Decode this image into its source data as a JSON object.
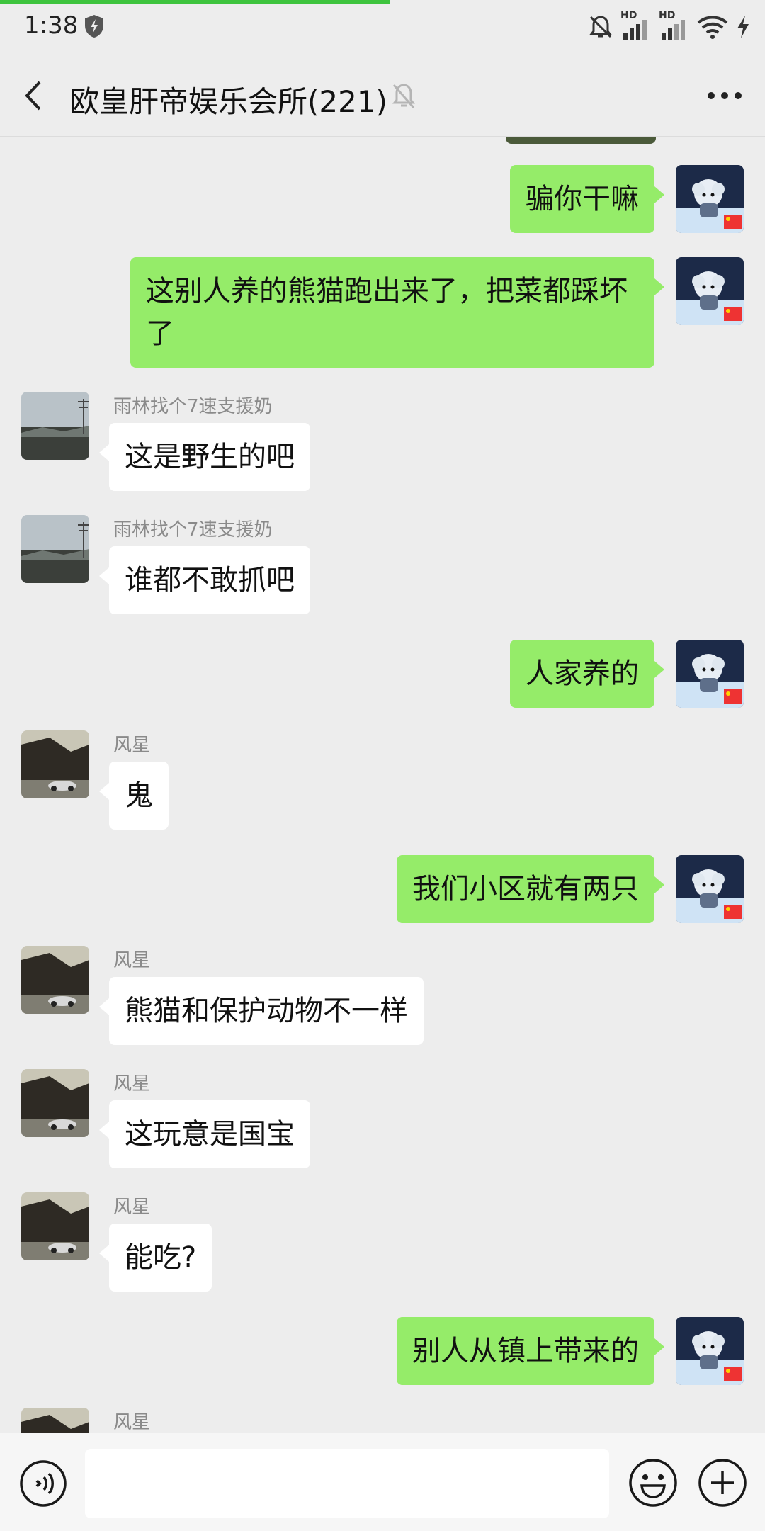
{
  "status_bar": {
    "time": "1:38",
    "icons": [
      "shield-icon",
      "mute-bell-icon",
      "hd-signal-icon",
      "hd-signal-icon",
      "wifi-icon",
      "charging-icon"
    ],
    "hd1": "HD",
    "hd2": "HD"
  },
  "header": {
    "title": "欧皇肝帝娱乐会所(221)",
    "back_icon": "back-arrow-icon",
    "mute_icon": "muted-bell-icon",
    "more_icon": "more-icon"
  },
  "colors": {
    "background": "#ededed",
    "outgoing_bubble": "#95ec69",
    "incoming_bubble": "#ffffff",
    "name_text": "#8a8a8a",
    "progress_bar": "#3ec43e"
  },
  "messages": [
    {
      "direction": "out",
      "text": "骗你干嘛"
    },
    {
      "direction": "out",
      "text": "这别人养的熊猫跑出来了，把菜都踩坏了"
    },
    {
      "direction": "in",
      "sender": "雨林找个7速支援奶",
      "text": "这是野生的吧"
    },
    {
      "direction": "in",
      "sender": "雨林找个7速支援奶",
      "text": "谁都不敢抓吧"
    },
    {
      "direction": "out",
      "text": "人家养的"
    },
    {
      "direction": "in",
      "sender": "风星",
      "text": "鬼"
    },
    {
      "direction": "out",
      "text": "我们小区就有两只"
    },
    {
      "direction": "in",
      "sender": "风星",
      "text": "熊猫和保护动物不一样"
    },
    {
      "direction": "in",
      "sender": "风星",
      "text": "这玩意是国宝"
    },
    {
      "direction": "in",
      "sender": "风星",
      "text": "能吃?"
    },
    {
      "direction": "out",
      "text": "别人从镇上带来的"
    },
    {
      "direction": "in",
      "sender": "风星",
      "text": ""
    }
  ],
  "input_bar": {
    "voice_icon": "voice-icon",
    "emoji_icon": "emoji-icon",
    "plus_icon": "plus-icon",
    "value": ""
  }
}
